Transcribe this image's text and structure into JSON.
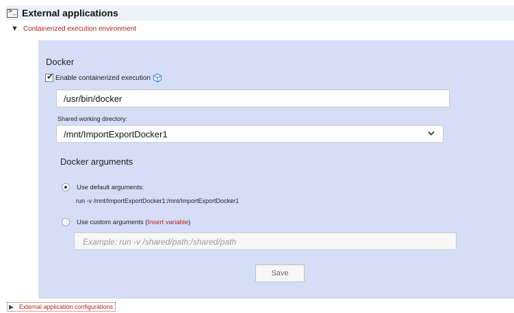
{
  "header": {
    "title": "External applications",
    "icon": "terminal-icon"
  },
  "section": {
    "label": "Containerized execution environment"
  },
  "docker": {
    "title": "Docker",
    "enable_label": "Enable containerized execution",
    "executable_path": "/usr/bin/docker",
    "shared_dir_label": "Shared working directory:",
    "shared_dir_value": "/mnt/ImportExportDocker1",
    "args_title": "Docker arguments",
    "default_label": "Use default arguments:",
    "default_command": "run -v /mnt/ImportExportDocker1:/mnt/ImportExportDocker1",
    "custom_label": "Use custom arguments (",
    "insert_variable": "Insert variable",
    "custom_label_end": ")",
    "custom_placeholder": "Example: run -v /shared/path:/shared/path",
    "save_label": "Save"
  },
  "footer": {
    "ext_config_label": "External application configurations"
  },
  "colors": {
    "panel_bg": "#d5def6",
    "link_red": "#b22222",
    "header_bg": "#eef1f8"
  }
}
